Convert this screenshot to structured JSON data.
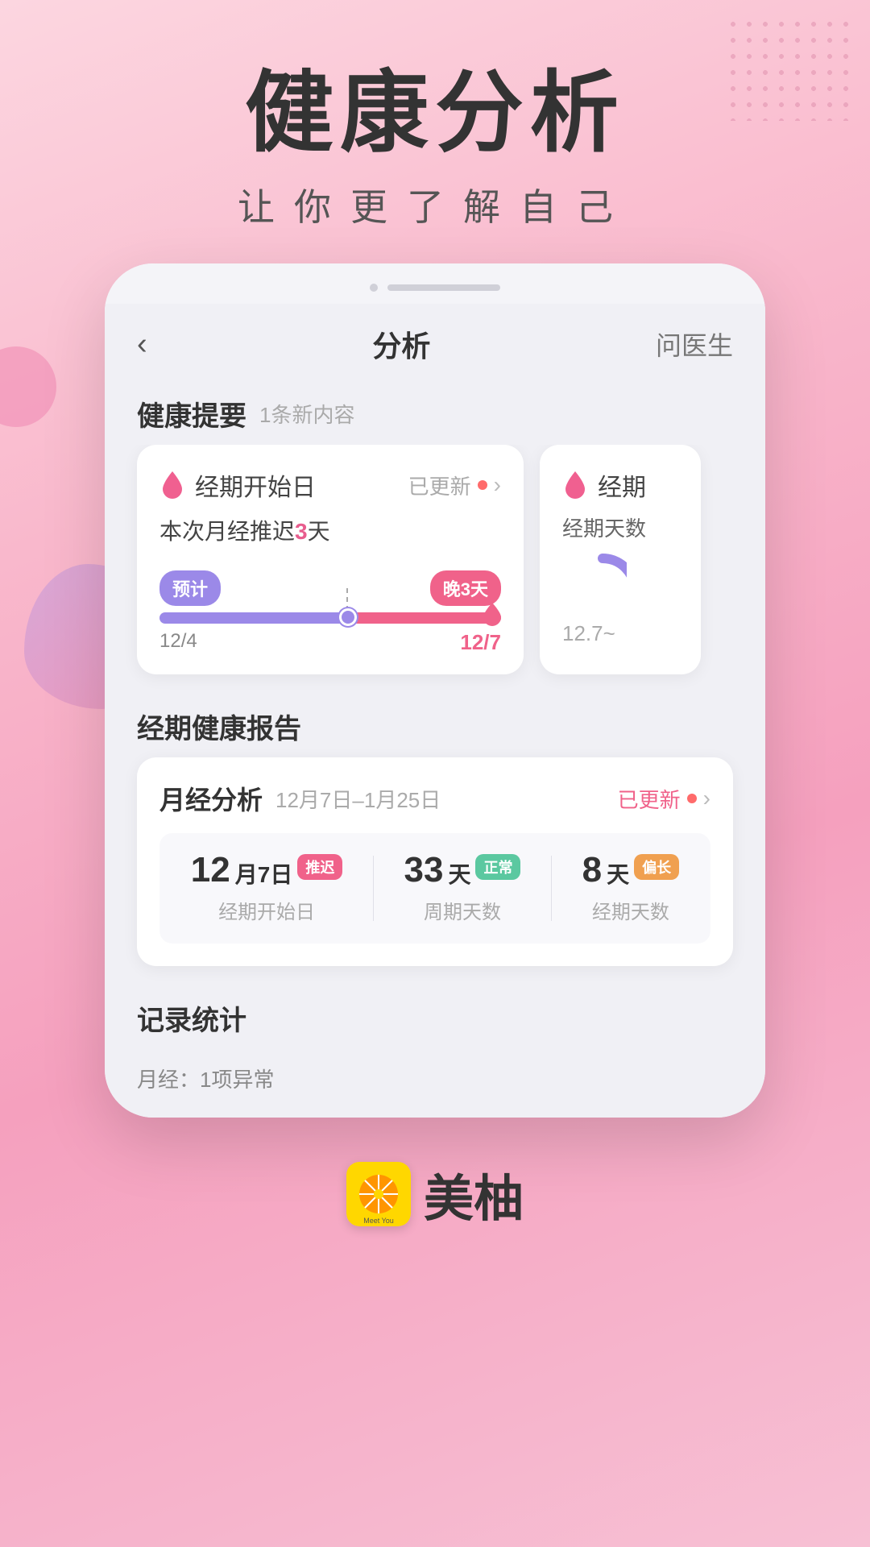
{
  "hero": {
    "title": "健康分析",
    "subtitle": "让你更了解自己"
  },
  "nav": {
    "back_label": "‹",
    "title": "分析",
    "action": "问医生"
  },
  "health_summary": {
    "section_title": "健康提要",
    "section_badge": "1条新内容",
    "card1": {
      "label": "经期开始日",
      "status": "已更新",
      "description": "本次月经推迟3天",
      "highlight": "3",
      "pill_left": "预计",
      "pill_right": "晚3天",
      "date_left": "12/4",
      "date_right": "12/7"
    },
    "card2": {
      "label": "经期",
      "sublabel": "经期天数",
      "value_partial": "12.7~"
    }
  },
  "period_report": {
    "section_title": "经期健康报告",
    "report_title": "月经分析",
    "date_range": "12月7日–1月25日",
    "status": "已更新",
    "stats": [
      {
        "value": "12",
        "unit": "月7日",
        "badge": "推迟",
        "badge_color": "badge-pink",
        "label": "经期开始日"
      },
      {
        "value": "33",
        "unit": "天",
        "badge": "正常",
        "badge_color": "badge-green",
        "label": "周期天数"
      },
      {
        "value": "8",
        "unit": "天",
        "badge": "偏长",
        "badge_color": "badge-orange",
        "label": "经期天数"
      }
    ]
  },
  "record_stats": {
    "section_title": "记录统计",
    "label": "月经：1项异常"
  },
  "brand": {
    "name": "美柚",
    "logo_alt": "Meetyou"
  }
}
